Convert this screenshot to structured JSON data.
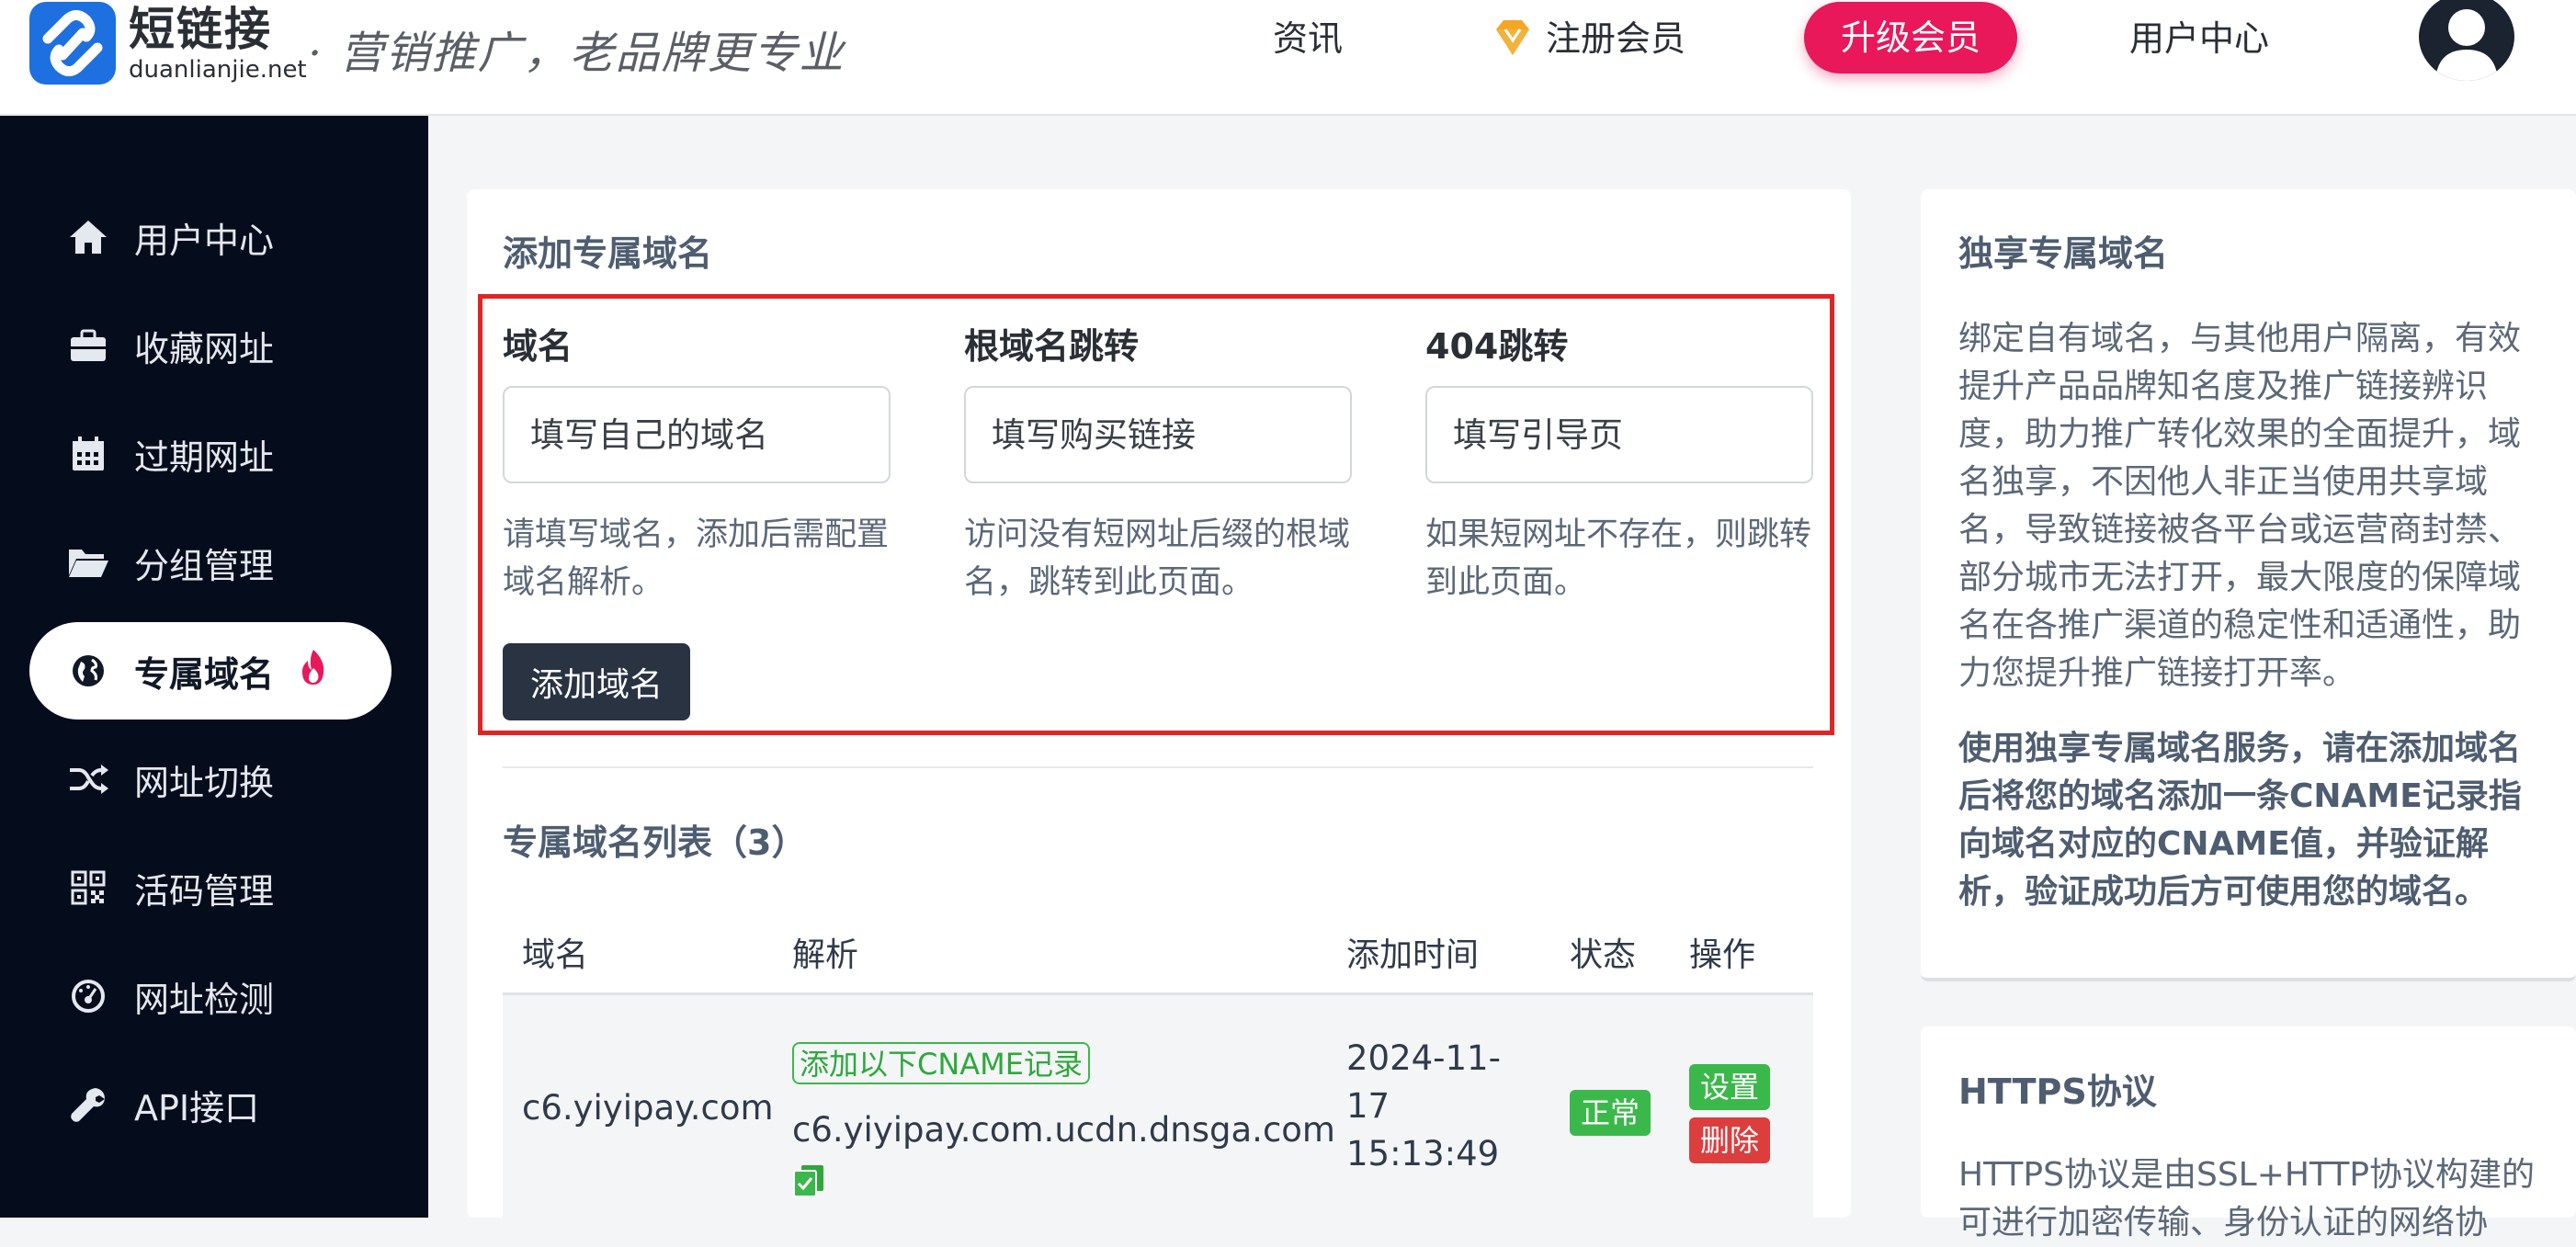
{
  "header": {
    "logo_cn": "短链接",
    "logo_en": "duanlianjie.net",
    "slogan": "· 营销推广，老品牌更专业",
    "nav": {
      "news": "资讯",
      "register": "注册会员",
      "upgrade": "升级会员",
      "user_center": "用户中心"
    },
    "colors": {
      "upgrade_bg": "#e8185a",
      "brand": "#1e6fe0"
    }
  },
  "sidebar": {
    "items": [
      {
        "label": "用户中心",
        "icon": "home-icon"
      },
      {
        "label": "收藏网址",
        "icon": "briefcase-icon"
      },
      {
        "label": "过期网址",
        "icon": "calendar-icon"
      },
      {
        "label": "分组管理",
        "icon": "folder-icon"
      },
      {
        "label": "专属域名",
        "icon": "globe-icon",
        "active": true,
        "badge_icon": "fire-icon"
      },
      {
        "label": "网址切换",
        "icon": "shuffle-icon"
      },
      {
        "label": "活码管理",
        "icon": "qrcode-icon"
      },
      {
        "label": "网址检测",
        "icon": "gauge-icon"
      },
      {
        "label": "API接口",
        "icon": "wrench-icon"
      }
    ]
  },
  "add_domain": {
    "title": "添加专属域名",
    "fields": [
      {
        "label": "域名",
        "placeholder": "填写自己的域名",
        "help": "请填写域名，添加后需配置域名解析。"
      },
      {
        "label": "根域名跳转",
        "placeholder": "填写购买链接",
        "help": "访问没有短网址后缀的根域名，跳转到此页面。"
      },
      {
        "label": "404跳转",
        "placeholder": "填写引导页",
        "help": "如果短网址不存在，则跳转到此页面。"
      }
    ],
    "submit_label": "添加域名"
  },
  "domain_list": {
    "title": "专属域名列表（3）",
    "columns": [
      "域名",
      "解析",
      "添加时间",
      "状态",
      "操作"
    ],
    "rows": [
      {
        "domain": "c6.yiyipay.com",
        "cname_tag": "添加以下CNAME记录",
        "cname_value": "c6.yiyipay.com.ucdn.dnsga.com",
        "added_line1": "2024-11-",
        "added_line2": "17",
        "added_line3": "15:13:49",
        "status": "正常",
        "action_set": "设置",
        "action_delete": "删除"
      }
    ]
  },
  "info_cards": [
    {
      "title": "独享专属域名",
      "body": "绑定自有域名，与其他用户隔离，有效提升产品品牌知名度及推广链接辨识度，助力推广转化效果的全面提升，域名独享，不因他人非正当使用共享域名，导致链接被各平台或运营商封禁、部分城市无法打开，最大限度的保障域名在各推广渠道的稳定性和适通性，助力您提升推广链接打开率。",
      "note": "使用独享专属域名服务，请在添加域名后将您的域名添加一条CNAME记录指向域名对应的CNAME值，并验证解析，验证成功后方可使用您的域名。"
    },
    {
      "title": "HTTPS协议",
      "body": "HTTPS协议是由SSL+HTTP协议构建的可进行加密传输、身份认证的网络协"
    }
  ]
}
